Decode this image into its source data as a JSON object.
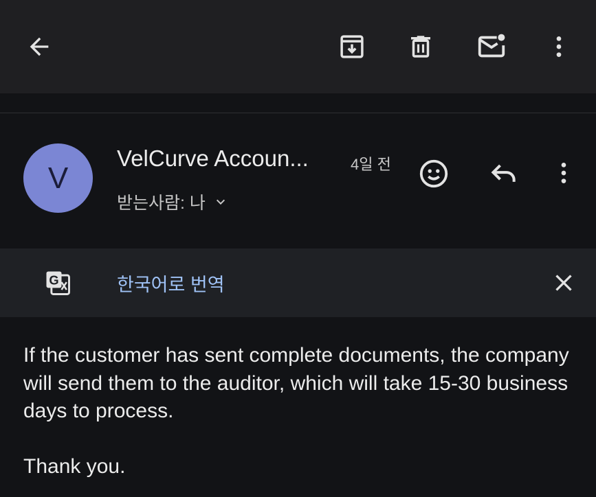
{
  "toolbar": {
    "actions": [
      {
        "name": "back",
        "icon": "arrow-left-icon"
      },
      {
        "name": "archive",
        "icon": "archive-icon"
      },
      {
        "name": "delete",
        "icon": "trash-icon"
      },
      {
        "name": "mark-unread",
        "icon": "mail-unread-icon"
      },
      {
        "name": "more",
        "icon": "more-vert-icon"
      }
    ]
  },
  "message": {
    "avatar_letter": "V",
    "avatar_color": "#7b86d4",
    "sender": "VelCurve Accoun...",
    "time": "4일 전",
    "recipient": "받는사람: 나",
    "body": "If the customer has sent complete documents, the company will send them to the auditor, which will take 15-30 business days to process.",
    "closing": "Thank you."
  },
  "translate": {
    "link_label": "한국어로 번역",
    "link_color": "#9fc2f6"
  }
}
